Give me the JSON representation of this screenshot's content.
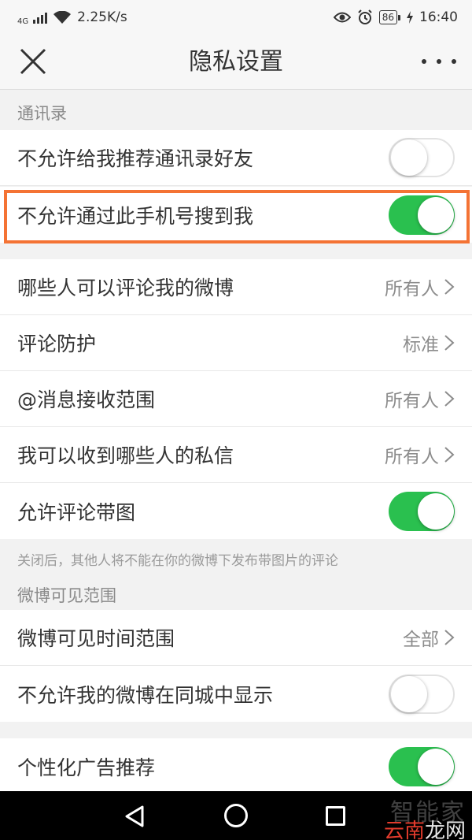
{
  "status_bar": {
    "network_type": "4G",
    "speed": "2.25K/s",
    "battery": "86",
    "time": "16:40"
  },
  "header": {
    "title": "隐私设置",
    "close_icon": "close-icon",
    "more_icon": "more-icon"
  },
  "sections": {
    "contacts": {
      "title": "通讯录",
      "items": [
        {
          "label": "不允许给我推荐通讯录好友",
          "toggle": "off"
        },
        {
          "label": "不允许通过此手机号搜到我",
          "toggle": "on"
        }
      ]
    },
    "interaction": {
      "items": [
        {
          "label": "哪些人可以评论我的微博",
          "value": "所有人"
        },
        {
          "label": "评论防护",
          "value": "标准"
        },
        {
          "label": "@消息接收范围",
          "value": "所有人"
        },
        {
          "label": "我可以收到哪些人的私信",
          "value": "所有人"
        },
        {
          "label": "允许评论带图",
          "toggle": "on"
        }
      ],
      "note": "关闭后，其他人将不能在你的微博下发布带图片的评论"
    },
    "visibility": {
      "title": "微博可见范围",
      "items": [
        {
          "label": "微博可见时间范围",
          "value": "全部"
        },
        {
          "label": "不允许我的微博在同城中显示",
          "toggle": "off"
        }
      ]
    },
    "ads": {
      "items": [
        {
          "label": "个性化广告推荐",
          "toggle": "on"
        }
      ]
    }
  },
  "watermark": {
    "top": "智能家",
    "bottom_red": "云南",
    "bottom_rest": "龙网"
  },
  "colors": {
    "toggle_on": "#2ac04f",
    "highlight": "#f47334",
    "background": "#f2f2f2"
  }
}
